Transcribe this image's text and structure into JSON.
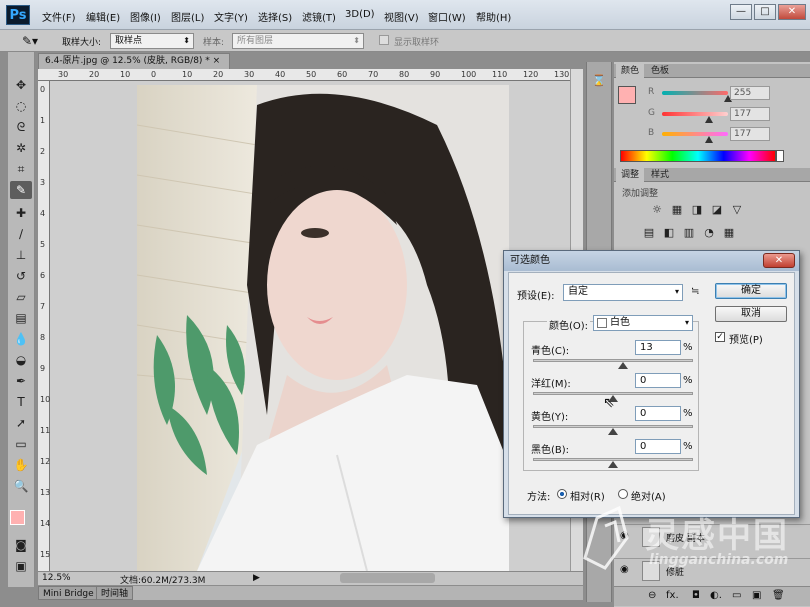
{
  "menubar": {
    "logo": "Ps",
    "items": [
      "文件(F)",
      "编辑(E)",
      "图像(I)",
      "图层(L)",
      "文字(Y)",
      "选择(S)",
      "滤镜(T)",
      "3D(D)",
      "视图(V)",
      "窗口(W)",
      "帮助(H)"
    ],
    "minimize": "—",
    "maximize": "□",
    "close": "✕"
  },
  "options": {
    "sample_size_label": "取样大小:",
    "sample_size_value": "取样点",
    "sample_label": "样本:",
    "sample_value": "所有图层",
    "show_ring_label": "显示取样环"
  },
  "document": {
    "tab_title": "6.4-原片.jpg @ 12.5% (皮肤, RGB/8) *",
    "close": "×",
    "zoom": "12.5%",
    "doc_info": "文档:60.2M/273.3M",
    "ruler_h": [
      "30",
      "20",
      "10",
      "0",
      "10",
      "20",
      "30",
      "40",
      "50",
      "60",
      "70",
      "80",
      "90",
      "100",
      "110",
      "120",
      "130"
    ],
    "ruler_v": [
      "0",
      "1",
      "2",
      "3",
      "4",
      "5",
      "6",
      "7",
      "8",
      "9",
      "10",
      "11",
      "12",
      "13",
      "14",
      "15"
    ]
  },
  "bottom_tabs": [
    "Mini Bridge",
    "时间轴"
  ],
  "color_panel": {
    "tabs": [
      "颜色",
      "色板"
    ],
    "channels": [
      {
        "label": "R",
        "value": "255",
        "fraction": 1.0
      },
      {
        "label": "G",
        "value": "177",
        "fraction": 0.694
      },
      {
        "label": "B",
        "value": "177",
        "fraction": 0.694
      }
    ],
    "foreground": "#ffb1b1"
  },
  "adjust_panel": {
    "tabs": [
      "调整",
      "样式"
    ],
    "subtitle": "添加调整",
    "row1": [
      "☼",
      "▦",
      "◨",
      "◪",
      "▽"
    ],
    "row2": [
      "▤",
      "◧",
      "▥",
      "◔",
      "▦"
    ]
  },
  "layers": {
    "rows": [
      {
        "name": "磨皮 副本"
      },
      {
        "name": "修脏"
      }
    ],
    "footer_icons": [
      "⊖",
      "fx.",
      "◘",
      "◐.",
      "▭",
      "▣",
      "🗑"
    ]
  },
  "dialog": {
    "title": "可选颜色",
    "close": "✕",
    "preset_label": "预设(E):",
    "preset_value": "自定",
    "ok": "确定",
    "cancel": "取消",
    "preview_label": "预览(P)",
    "preview_checked": "✓",
    "colors_label": "颜色(O):",
    "colors_value": "白色",
    "sliders": [
      {
        "label": "青色(C):",
        "value": "13",
        "fraction": 0.565
      },
      {
        "label": "洋红(M):",
        "value": "0",
        "fraction": 0.5
      },
      {
        "label": "黄色(Y):",
        "value": "0",
        "fraction": 0.5
      },
      {
        "label": "黑色(B):",
        "value": "0",
        "fraction": 0.5
      }
    ],
    "percent": "%",
    "method_label": "方法:",
    "method_relative": "相对(R)",
    "method_absolute": "绝对(A)"
  },
  "watermark": {
    "cn": "灵感中国",
    "url": "lingganchina.com"
  },
  "colors": {
    "ps_blue": "#35a8ff",
    "fg_swatch": "#ffb1b1",
    "leaf_green": "#4e9a6b"
  }
}
